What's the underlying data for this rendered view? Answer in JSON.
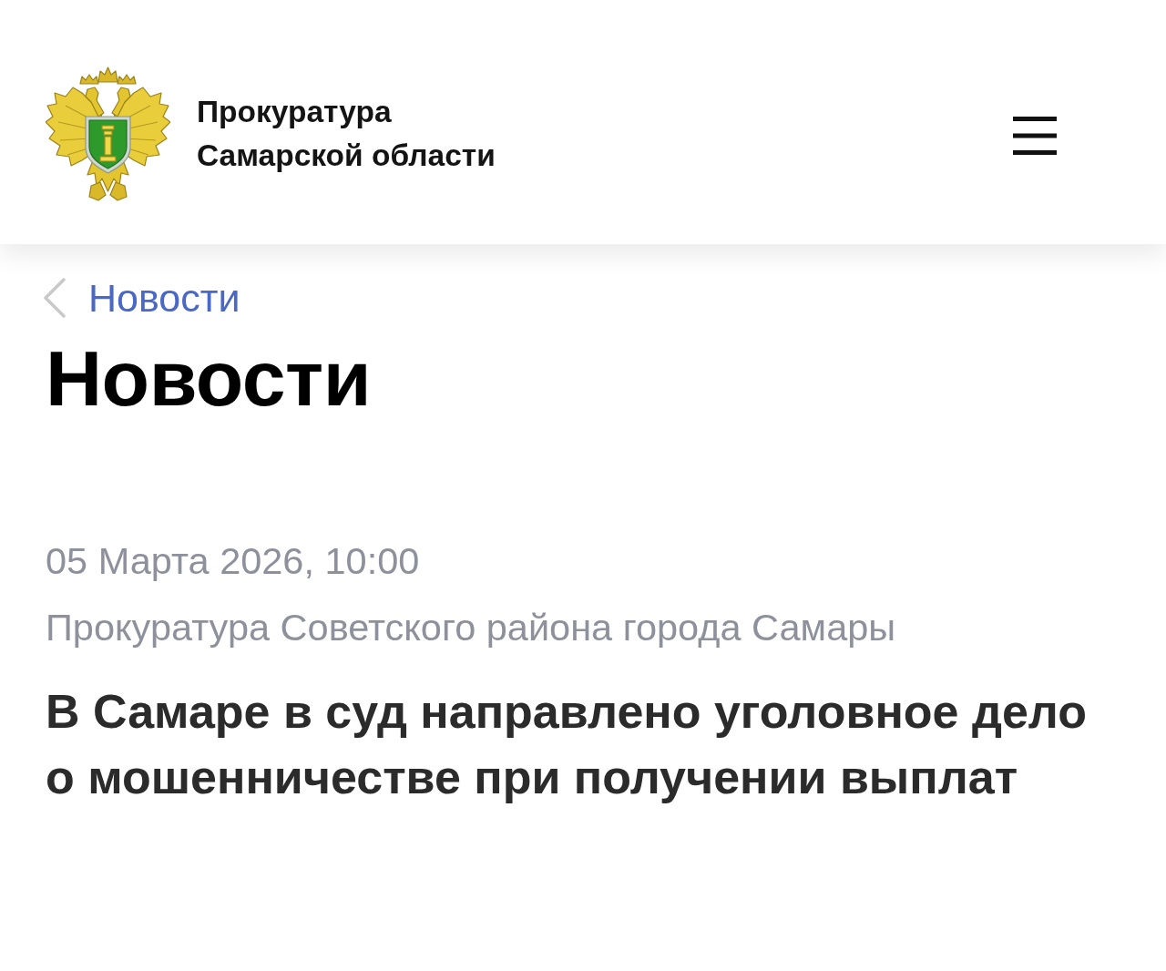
{
  "header": {
    "title": "Прокуратура Самарской области"
  },
  "breadcrumb": {
    "label": "Новости"
  },
  "page_title": "Новости",
  "article": {
    "date": "05 Марта 2026, 10:00",
    "source": "Прокуратура Советского района города Самары",
    "headline": "В Самаре в суд направлено уголовное дело о мошенничестве при получении выплат"
  }
}
